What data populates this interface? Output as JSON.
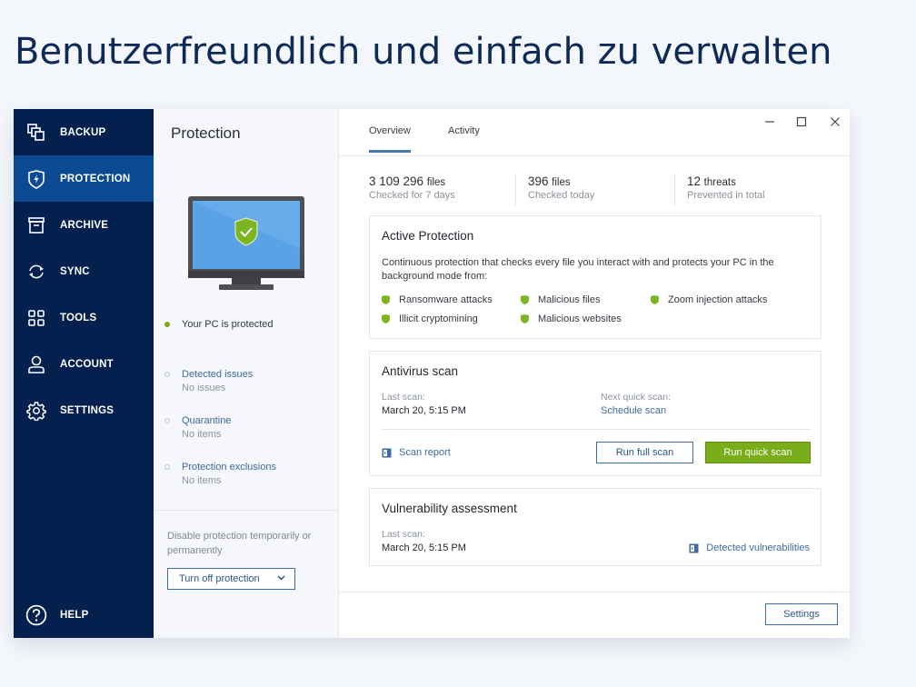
{
  "headline": "Benutzerfreundlich und einfach zu verwalten",
  "colors": {
    "sidebar": "#03204e",
    "sidebar_active": "#0c4a93",
    "accent_green": "#79ad1a",
    "link_blue": "#3b6aa0",
    "heading_navy": "#0e2a56"
  },
  "sidebar": {
    "items": [
      {
        "label": "BACKUP",
        "icon": "backup-copy-icon",
        "active": false
      },
      {
        "label": "PROTECTION",
        "icon": "shield-bolt-icon",
        "active": true
      },
      {
        "label": "ARCHIVE",
        "icon": "archive-box-icon",
        "active": false
      },
      {
        "label": "SYNC",
        "icon": "sync-arrows-icon",
        "active": false
      },
      {
        "label": "TOOLS",
        "icon": "grid-tools-icon",
        "active": false
      },
      {
        "label": "ACCOUNT",
        "icon": "user-icon",
        "active": false
      },
      {
        "label": "SETTINGS",
        "icon": "gear-icon",
        "active": false
      }
    ],
    "help": {
      "label": "HELP",
      "icon": "question-circle-icon"
    }
  },
  "middle": {
    "title": "Protection",
    "status": "Your PC is protected",
    "links": [
      {
        "label": "Detected issues",
        "sub": "No issues"
      },
      {
        "label": "Quarantine",
        "sub": "No items"
      },
      {
        "label": "Protection exclusions",
        "sub": "No items"
      }
    ],
    "disable_desc": "Disable protection temporarily or permanently",
    "turn_off_label": "Turn off protection"
  },
  "main": {
    "tabs": [
      {
        "label": "Overview",
        "active": true
      },
      {
        "label": "Activity",
        "active": false
      }
    ],
    "window_controls": {
      "minimize": "minimize-icon",
      "maximize": "maximize-icon",
      "close": "close-icon"
    },
    "stats": [
      {
        "value": "3 109 296",
        "unit": "files",
        "caption": "Checked for 7 days"
      },
      {
        "value": "396",
        "unit": "files",
        "caption": "Checked today"
      },
      {
        "value": "12",
        "unit": "threats",
        "caption": "Prevented in total"
      }
    ],
    "active_protection": {
      "title": "Active Protection",
      "description": "Continuous protection that checks every file you interact with and protects your PC in the background mode from:",
      "features": [
        "Ransomware attacks",
        "Malicious files",
        "Zoom injection attacks",
        "Illicit cryptomining",
        "Malicious websites"
      ]
    },
    "antivirus": {
      "title": "Antivirus scan",
      "last_scan_label": "Last scan:",
      "last_scan_value": "March 20, 5:15 PM",
      "next_scan_label": "Next quick scan:",
      "next_scan_link": "Schedule scan",
      "report_link": "Scan report",
      "full_scan_button": "Run full scan",
      "quick_scan_button": "Run quick scan"
    },
    "vulnerability": {
      "title": "Vulnerability assessment",
      "last_scan_label": "Last scan:",
      "last_scan_value": "March 20, 5:15 PM",
      "detected_link": "Detected vulnerabilities"
    },
    "settings_button": "Settings"
  }
}
